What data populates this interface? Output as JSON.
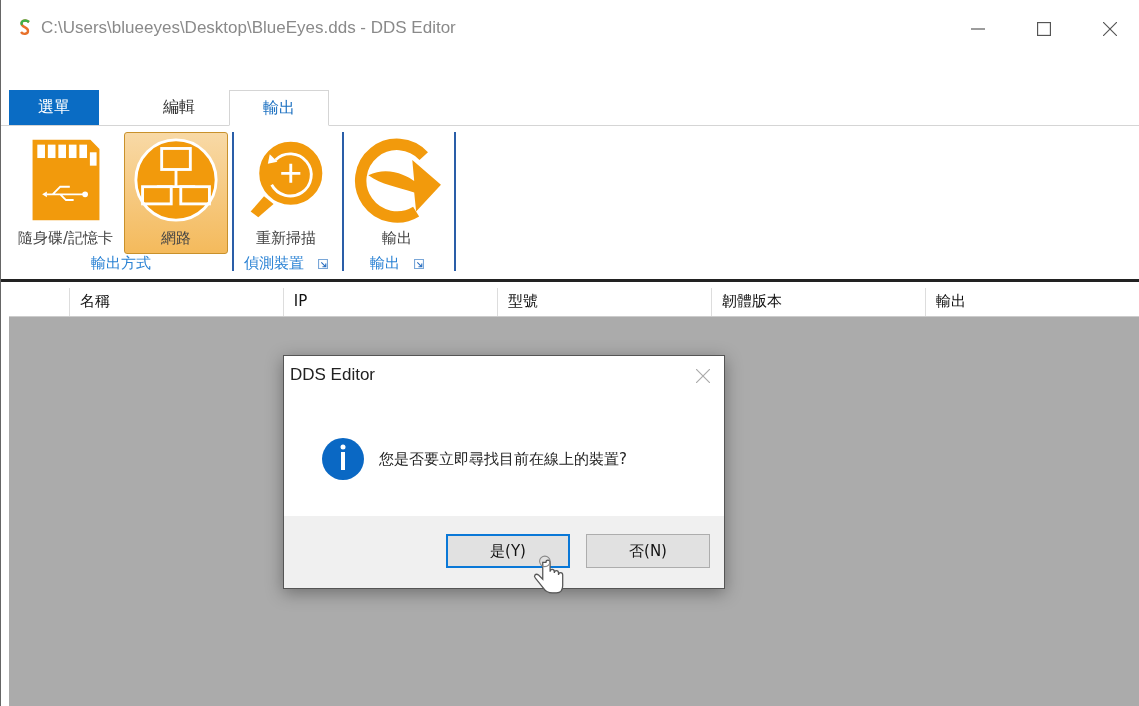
{
  "window": {
    "title": "C:\\Users\\blueeyes\\Desktop\\BlueEyes.dds - DDS Editor"
  },
  "ribbon_tabs": [
    {
      "label": "選單",
      "kind": "file",
      "selected": false
    },
    {
      "label": "編輯",
      "kind": "tab",
      "selected": false
    },
    {
      "label": "輸出",
      "kind": "tab",
      "selected": true
    }
  ],
  "ribbon_groups": [
    {
      "label": "輸出方式",
      "launcher": false,
      "buttons": [
        {
          "label": "隨身碟/記憶卡",
          "kind": "sdcard",
          "selected": false
        },
        {
          "label": "網路",
          "kind": "network",
          "selected": true
        }
      ]
    },
    {
      "label": "偵測裝置",
      "launcher": true,
      "buttons": [
        {
          "label": "重新掃描",
          "kind": "rescan",
          "selected": false
        }
      ]
    },
    {
      "label": "輸出",
      "launcher": true,
      "buttons": [
        {
          "label": "輸出",
          "kind": "export",
          "selected": false
        }
      ]
    }
  ],
  "table": {
    "columns": [
      "名稱",
      "IP",
      "型號",
      "韌體版本",
      "輸出"
    ]
  },
  "dialog": {
    "title": "DDS Editor",
    "message": "您是否要立即尋找目前在線上的裝置?",
    "buttons": [
      {
        "label": "是(Y)",
        "focused": true
      },
      {
        "label": "否(N)",
        "focused": false
      }
    ]
  }
}
